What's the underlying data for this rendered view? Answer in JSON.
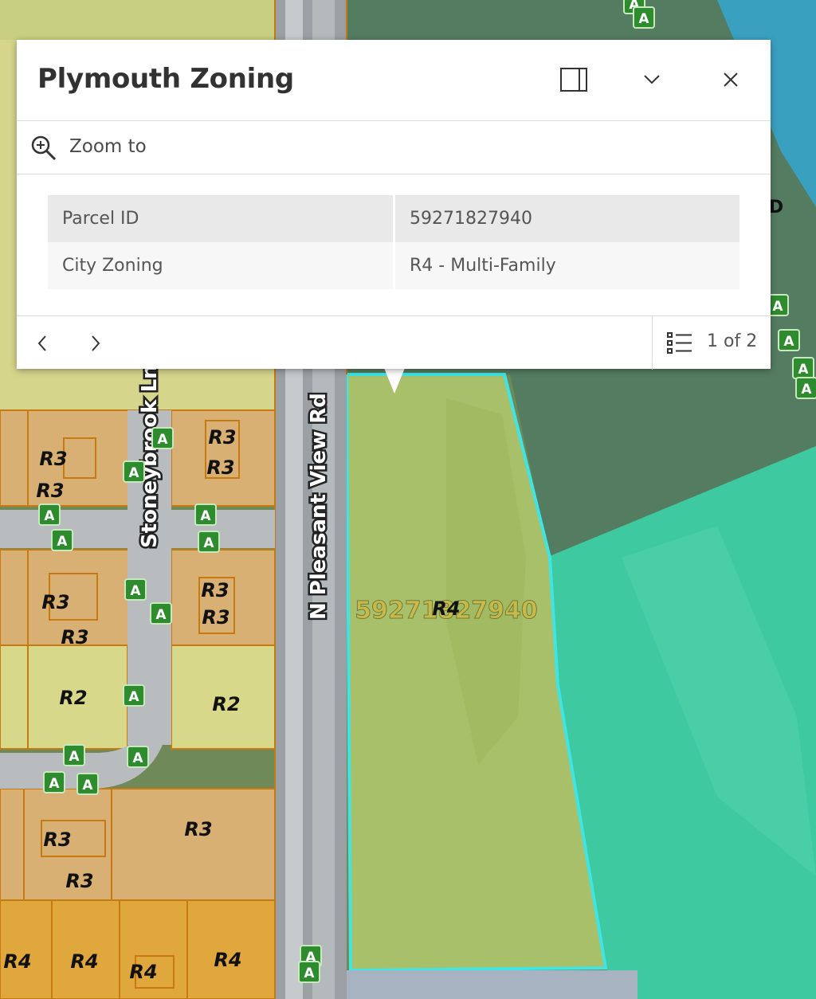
{
  "popup": {
    "title": "Plymouth Zoning",
    "dock_icon": "dock-side-panel-icon",
    "collapse_icon": "chevron-down-icon",
    "close_icon": "close-icon",
    "action": {
      "label": "Zoom to",
      "icon": "zoom-in-magnifier-icon"
    },
    "fields": [
      {
        "key": "Parcel ID",
        "value": "59271827940"
      },
      {
        "key": "City Zoning",
        "value": "R4 - Multi-Family"
      }
    ],
    "footer": {
      "prev_icon": "chevron-left-icon",
      "next_icon": "chevron-right-icon",
      "list_icon": "feature-list-icon",
      "page_text": "1 of 2"
    }
  },
  "map": {
    "street_labels": [
      "Stoneybrook Ln",
      "N Pleasant View Rd"
    ],
    "parcel_label": "59271827940",
    "parcel_zone": "R4",
    "zone_labels": [
      "R3",
      "R3",
      "R3",
      "R3",
      "R3",
      "R3",
      "R3",
      "R3",
      "R3",
      "R3",
      "R2",
      "R2",
      "R3",
      "R3",
      "R3",
      "R4",
      "R4",
      "R4",
      "R4"
    ],
    "marker_text": "A",
    "edge_text": "D",
    "colors": {
      "selection_outline": "#3fe4e4",
      "parcel_fill": "#a9c06a",
      "r3_fill": "#d8b074",
      "r2_fill": "#d8d88a",
      "r4_fill": "#e0a83c",
      "green_zone": "#3fc9a0",
      "water": "#3aa0c0",
      "marker": "#2e8b2e",
      "parcel_line": "#c77a10"
    }
  }
}
